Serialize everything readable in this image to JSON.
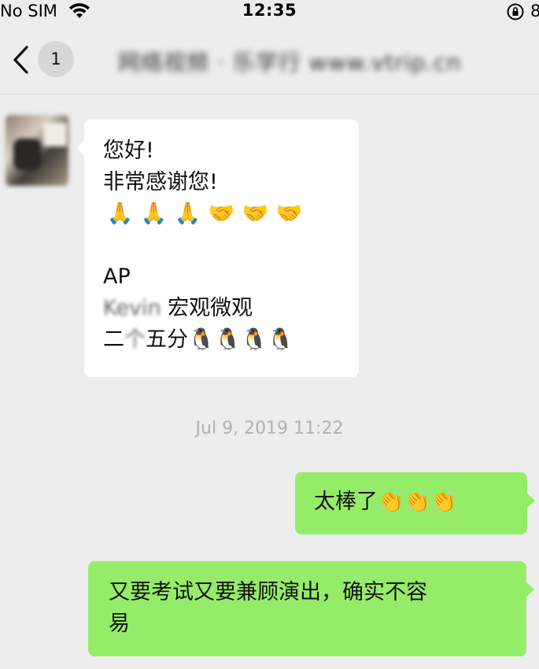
{
  "status_bar": {
    "carrier": "No SIM",
    "time": "12:35",
    "battery_digit": "8"
  },
  "nav": {
    "unread_count": "1",
    "title": "网络视频 · 乐学行 www.vtrip.cn"
  },
  "messages": {
    "incoming": {
      "line1": "您好!",
      "line2": "非常感谢您!",
      "emoji_row": [
        "🙏",
        "🙏",
        "🙏",
        "🤝",
        "🤝",
        "🤝"
      ],
      "line4": "AP",
      "line5_name": "Kevin",
      "line5_text": " 宏观微观",
      "line6_prefix": "二",
      "line6_blur": "个",
      "line6_text": "五分",
      "line6_emoji": "🐧🐧🐧🐧"
    },
    "timestamp": "Jul 9, 2019 11:22",
    "outgoing1": {
      "text": "太棒了",
      "emoji": "👏👏👏"
    },
    "outgoing2": {
      "line1": "又要考试又要兼顾演出，确实不容",
      "line2": "易"
    }
  },
  "colors": {
    "background": "#ededed",
    "incoming_bubble": "#ffffff",
    "outgoing_bubble": "#95ec69",
    "timestamp_text": "#b2b2b2"
  },
  "icons": [
    "wifi-icon",
    "rotation-lock-icon",
    "back-chevron-icon"
  ]
}
